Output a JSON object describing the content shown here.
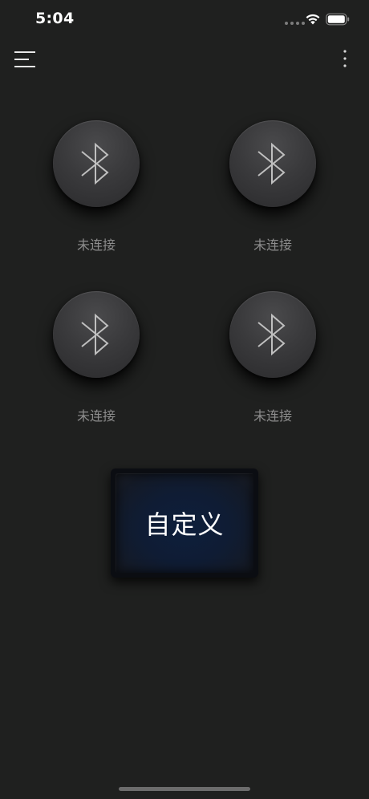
{
  "status_bar": {
    "time": "5:04"
  },
  "app_bar": {
    "menu_icon": "hamburger-menu-icon",
    "more_icon": "more-vertical-icon"
  },
  "devices": [
    {
      "icon": "bluetooth-icon",
      "status": "未连接"
    },
    {
      "icon": "bluetooth-icon",
      "status": "未连接"
    },
    {
      "icon": "bluetooth-icon",
      "status": "未连接"
    },
    {
      "icon": "bluetooth-icon",
      "status": "未连接"
    }
  ],
  "custom_button": {
    "label": "自定义"
  },
  "colors": {
    "background": "#1f201f",
    "status_text": "#8d8d8d",
    "custom_button_face": "#0e1f3c"
  }
}
